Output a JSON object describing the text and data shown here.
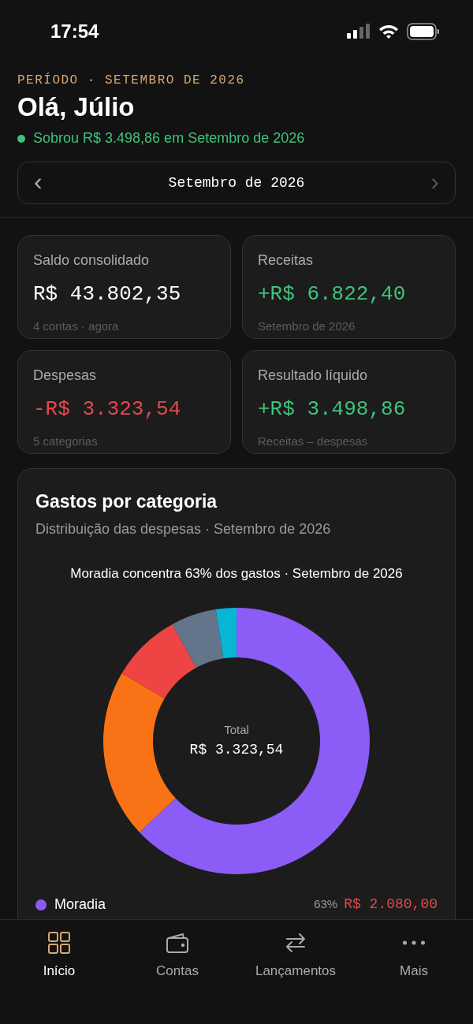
{
  "status_bar": {
    "time": "17:54"
  },
  "header": {
    "period": "PERÍODO · SETEMBRO DE 2026",
    "greeting": "Olá, Júlio",
    "summary": "Sobrou R$ 3.498,86 em Setembro de 2026",
    "month_picker": {
      "prev": "‹",
      "label": "Setembro de 2026",
      "next": "›"
    }
  },
  "stats": [
    {
      "label": "Saldo consolidado",
      "value": "R$ 43.802,35",
      "kind": "neutral",
      "note": "4 contas · agora"
    },
    {
      "label": "Receitas",
      "value": "+R$ 6.822,40",
      "kind": "positive",
      "note": "Setembro de 2026"
    },
    {
      "label": "Despesas",
      "value": "-R$ 3.323,54",
      "kind": "negative",
      "note": "5 categorias"
    },
    {
      "label": "Resultado líquido",
      "value": "+R$ 3.498,86",
      "kind": "positive",
      "note": "Receitas – despesas"
    }
  ],
  "chart_card": {
    "title": "Gastos por categoria",
    "subtitle": "Distribuição das despesas · Setembro de 2026",
    "caption": "Moradia concentra 63% dos gastos · Setembro de 2026",
    "center_label": "Total",
    "center_value": "R$ 3.323,54",
    "legend": [
      {
        "name": "Moradia",
        "color": "#8b5cf6",
        "share": "63%",
        "amount": "R$ 2.080,00"
      }
    ]
  },
  "tab_bar": [
    {
      "label": "Início",
      "selected": true
    },
    {
      "label": "Contas",
      "selected": false
    },
    {
      "label": "Lançamentos",
      "selected": false
    },
    {
      "label": "Mais",
      "selected": false
    }
  ]
}
